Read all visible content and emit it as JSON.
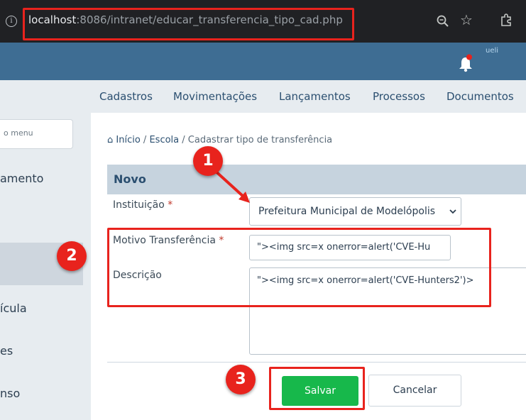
{
  "browser": {
    "url_host": "localhost",
    "url_rest": ":8086/intranet/educar_transferencia_tipo_cad.php",
    "info_icon": "i"
  },
  "header": {
    "avatar_text": "ueli"
  },
  "sidebar": {
    "search_placeholder": "o menu",
    "items": [
      "amento",
      "ícula",
      "es",
      "nso"
    ]
  },
  "topmenu": {
    "items": [
      "Cadastros",
      "Movimentações",
      "Lançamentos",
      "Processos",
      "Documentos"
    ]
  },
  "breadcrumb": {
    "home": "Início",
    "sep1": " / ",
    "section": "Escola",
    "sep2": " / ",
    "current": "Cadastrar tipo de transferência"
  },
  "form": {
    "title": "Novo",
    "instituicao_label": "Instituição",
    "required_marker": "*",
    "instituicao_value": "Prefeitura Municipal de Modelópolis",
    "motivo_label": "Motivo Transferência",
    "motivo_value": "\"><img src=x onerror=alert('CVE-Hu",
    "descricao_label": "Descrição",
    "descricao_value": "\"><img src=x onerror=alert('CVE-Hunters2')>",
    "save_label": "Salvar",
    "cancel_label": "Cancelar"
  },
  "annotations": {
    "step1": "1",
    "step2": "2",
    "step3": "3",
    "color": "#e8231d"
  },
  "colors": {
    "header": "#3e6d93",
    "save_button": "#17b84b",
    "accent_text": "#2b4f70"
  }
}
